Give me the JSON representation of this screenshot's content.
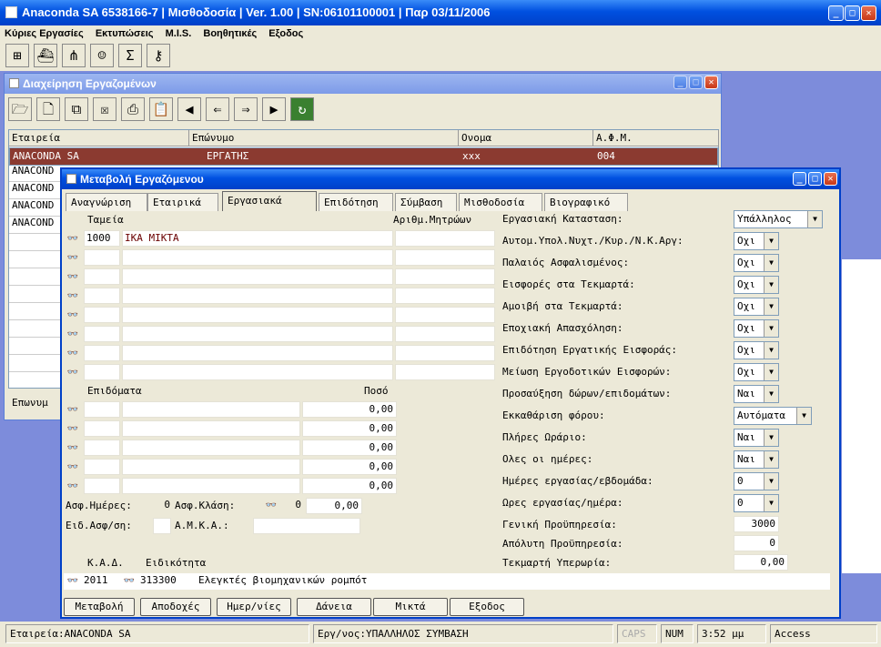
{
  "app": {
    "title": "Anaconda SA 6538166-7 | Μισθοδοσία | Ver. 1.00 | SN:06101100001 | Παρ 03/11/2006"
  },
  "menu": [
    "Κύριες Εργασίες",
    "Εκτυπώσεις",
    "M.I.S.",
    "Βοηθητικές",
    "Εξοδος"
  ],
  "main_toolbar": [
    "org-chart-icon",
    "ship-icon",
    "network-icon",
    "smiley-icon",
    "sigma-icon",
    "key-icon"
  ],
  "mgmt": {
    "title": "Διαχείρηση Εργαζομένων",
    "toolbar": [
      "open-folder-icon",
      "new-file-icon",
      "copy-icon",
      "delete-icon",
      "print-icon",
      "clipboard-icon",
      "first-record-icon",
      "previous-record-icon",
      "next-record-icon",
      "last-record-icon",
      "refresh-icon"
    ],
    "columns": [
      "Εταιρεία",
      "Επώνυμο",
      "Ονομα",
      "Α.Φ.Μ."
    ],
    "selected_row": [
      "ANACONDA SA",
      "ΕΡΓΑΤΗΣ",
      "xxx",
      "004"
    ],
    "other_rows": [
      "ANACOND",
      "ANACOND",
      "ANACOND",
      "ANACOND"
    ],
    "bottom_label": "Επωνυμ"
  },
  "edit": {
    "title": "Μεταβολή Εργαζόμενου",
    "tabs": [
      "Αναγνώριση",
      "Εταιρικά",
      "Εργασιακά",
      "Επιδότηση",
      "Σύμβαση",
      "Μισθοδοσία",
      "Βιογραφικό"
    ],
    "active_tab": "Εργασιακά",
    "funds_label": "Ταμεία",
    "registry_label": "Αριθμ.Μητρώων",
    "fund_code": "1000",
    "fund_name": "ΙΚΑ ΜΙΚΤΑ",
    "benefits_label": "Επιδόματα",
    "amount_label": "Ποσό",
    "amounts": [
      "0,00",
      "0,00",
      "0,00",
      "0,00",
      "0,00"
    ],
    "ins_days_label": "Ασφ.Ημέρες:",
    "ins_days": "0",
    "ins_class_label": "Ασφ.Κλάση:",
    "ins_class": "0",
    "ins_class_amount": "0,00",
    "special_ins_label": "Ειδ.Ασφ/ση:",
    "amka_label": "Α.Μ.Κ.Α.:",
    "kad_label": "Κ.Α.Δ.",
    "specialty_label": "Ειδικότητα",
    "kad_code": "2011",
    "specialty_code": "313300",
    "specialty_name": "Ελεγκτές βιομηχανικών ρομπότ",
    "right": [
      {
        "label": "Εργασιακή Κατασταση:",
        "value": "Υπάλληλος",
        "type": "select"
      },
      {
        "label": "Αυτομ.Υπολ.Νυχτ./Κυρ./Ν.Κ.Αργ:",
        "value": "Οχι",
        "type": "select"
      },
      {
        "label": "Παλαιός Ασφαλισμένος:",
        "value": "Οχι",
        "type": "select"
      },
      {
        "label": "Εισφορές στα Τεκμαρτά:",
        "value": "Οχι",
        "type": "select"
      },
      {
        "label": "Αμοιβή στα Τεκμαρτά:",
        "value": "Οχι",
        "type": "select"
      },
      {
        "label": "Εποχιακή Απασχόληση:",
        "value": "Οχι",
        "type": "select"
      },
      {
        "label": "Επιδότηση Εργατικής Εισφοράς:",
        "value": "Οχι",
        "type": "select"
      },
      {
        "label": "Μείωση Εργοδοτικών Εισφορών:",
        "value": "Οχι",
        "type": "select"
      },
      {
        "label": "Προσαύξηση δώρων/επιδομάτων:",
        "value": "Ναι",
        "type": "select"
      },
      {
        "label": "Εκκαθάριση φόρου:",
        "value": "Αυτόματα",
        "type": "select"
      },
      {
        "label": "Πλήρες Ωράριο:",
        "value": "Ναι",
        "type": "select"
      },
      {
        "label": "Ολες οι ημέρες:",
        "value": "Ναι",
        "type": "select"
      },
      {
        "label": "Ημέρες εργασίας/εβδομάδα:",
        "value": "0",
        "type": "select"
      },
      {
        "label": "Ωρες εργασίας/ημέρα:",
        "value": "0",
        "type": "select"
      },
      {
        "label": "Γενική Προϋπηρεσία:",
        "value": "3000",
        "type": "num"
      },
      {
        "label": "Απόλυτη Προϋπηρεσία:",
        "value": "0",
        "type": "num"
      },
      {
        "label": "Τεκμαρτή Υπερωρία:",
        "value": "0,00",
        "type": "num"
      }
    ],
    "buttons": [
      "Μεταβολή",
      "Αποδοχές",
      "Ημερ/νίες",
      "Δάνεια",
      "Μικτά",
      "Εξοδος"
    ]
  },
  "status": {
    "company": "Εταιρεία:ANACONDA SA",
    "employee": "Εργ/νος:ΥΠΑΛΛΗΛΟΣ ΣΥΜΒΑΣΗ",
    "caps": "CAPS",
    "num": "NUM",
    "time": "3:52 μμ",
    "app": "Access"
  }
}
